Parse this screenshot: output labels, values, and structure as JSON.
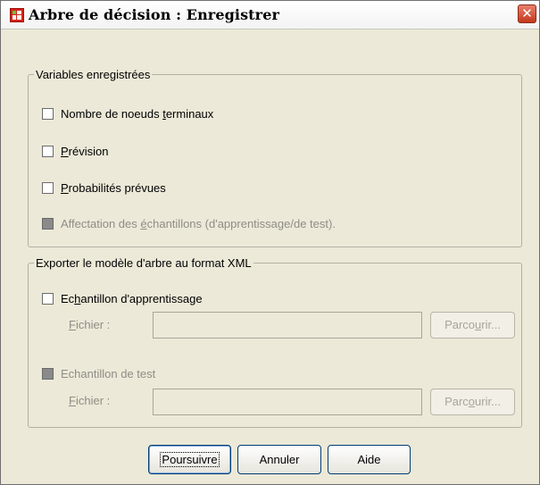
{
  "window": {
    "title": "Arbre de décision : Enregistrer",
    "close_label": "✕"
  },
  "saved_variables": {
    "legend": "Variables enregistrées",
    "items": [
      {
        "pre": "Nombre de noeuds ",
        "ul": "t",
        "post": "erminaux",
        "checked": false,
        "enabled": true
      },
      {
        "pre": "",
        "ul": "P",
        "post": "révision",
        "checked": false,
        "enabled": true
      },
      {
        "pre": "",
        "ul": "P",
        "post": "robabilités prévues",
        "checked": false,
        "enabled": true
      },
      {
        "pre": "Affectation des ",
        "ul": "é",
        "post": "chantillons (d'apprentissage/de test).",
        "checked": false,
        "enabled": false
      }
    ]
  },
  "export_xml": {
    "legend": "Exporter le modèle d'arbre au format XML",
    "training": {
      "pre": "Ec",
      "ul": "h",
      "post": "antillon d'apprentissage",
      "file_pre": "",
      "file_ul": "F",
      "file_post": "ichier :",
      "file_value": "",
      "browse_pre": "Parco",
      "browse_ul": "u",
      "browse_post": "rir..."
    },
    "test": {
      "label": "Echantillon de test",
      "file_pre": "",
      "file_ul": "F",
      "file_post": "ichier :",
      "file_value": "",
      "browse_pre": "Parc",
      "browse_ul": "o",
      "browse_post": "urir..."
    }
  },
  "buttons": {
    "continue": "Poursuivre",
    "cancel": "Annuler",
    "help": "Aide"
  },
  "colors": {
    "dialog_bg": "#ece9d8",
    "close_red": "#c4391c",
    "button_border": "#003c74"
  }
}
